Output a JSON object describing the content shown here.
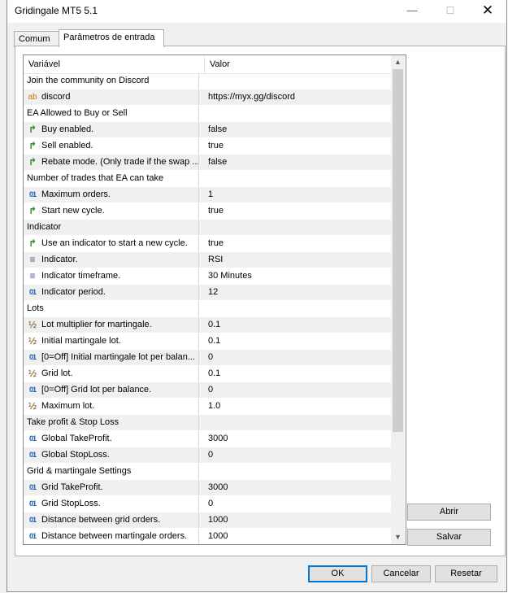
{
  "window": {
    "title": "Gridingale MT5 5.1"
  },
  "tabs": [
    {
      "label": "Comum"
    },
    {
      "label": "Parâmetros de entrada"
    }
  ],
  "grid": {
    "headers": {
      "name": "Variável",
      "value": "Valor"
    },
    "rows": [
      {
        "type": "group",
        "name": "Join the community on Discord",
        "value": ""
      },
      {
        "type": "param",
        "icon": "string-icon",
        "name": "discord",
        "value": "https://myx.gg/discord"
      },
      {
        "type": "group",
        "name": "EA Allowed to Buy or Sell",
        "value": ""
      },
      {
        "type": "param",
        "icon": "bool-icon",
        "name": "Buy enabled.",
        "value": "false"
      },
      {
        "type": "param",
        "icon": "bool-icon",
        "name": "Sell enabled.",
        "value": "true"
      },
      {
        "type": "param",
        "icon": "bool-icon",
        "name": "Rebate mode. (Only trade if the swap ...",
        "value": "false"
      },
      {
        "type": "group",
        "name": "Number of trades that EA can take",
        "value": ""
      },
      {
        "type": "param",
        "icon": "integer-icon",
        "name": "Maximum orders.",
        "value": "1"
      },
      {
        "type": "param",
        "icon": "bool-icon",
        "name": "Start new cycle.",
        "value": "true"
      },
      {
        "type": "group",
        "name": "Indicator",
        "value": ""
      },
      {
        "type": "param",
        "icon": "bool-icon",
        "name": "Use an indicator to start a new cycle.",
        "value": "true"
      },
      {
        "type": "param",
        "icon": "enum-icon",
        "name": "Indicator.",
        "value": "RSI"
      },
      {
        "type": "param",
        "icon": "enum-icon",
        "name": "Indicator timeframe.",
        "value": "30 Minutes"
      },
      {
        "type": "param",
        "icon": "integer-icon",
        "name": "Indicator period.",
        "value": "12"
      },
      {
        "type": "group",
        "name": "Lots",
        "value": ""
      },
      {
        "type": "param",
        "icon": "double-icon",
        "name": "Lot multiplier for martingale.",
        "value": "0.1"
      },
      {
        "type": "param",
        "icon": "double-icon",
        "name": "Initial martingale lot.",
        "value": "0.1"
      },
      {
        "type": "param",
        "icon": "integer-icon",
        "name": "[0=Off] Initial martingale lot per balan...",
        "value": "0"
      },
      {
        "type": "param",
        "icon": "double-icon",
        "name": "Grid lot.",
        "value": "0.1"
      },
      {
        "type": "param",
        "icon": "integer-icon",
        "name": "[0=Off] Grid lot per balance.",
        "value": "0"
      },
      {
        "type": "param",
        "icon": "double-icon",
        "name": "Maximum lot.",
        "value": "1.0"
      },
      {
        "type": "group",
        "name": "Take profit & Stop Loss",
        "value": ""
      },
      {
        "type": "param",
        "icon": "integer-icon",
        "name": "Global TakeProfit.",
        "value": "3000"
      },
      {
        "type": "param",
        "icon": "integer-icon",
        "name": "Global StopLoss.",
        "value": "0"
      },
      {
        "type": "group",
        "name": "Grid & martingale Settings",
        "value": ""
      },
      {
        "type": "param",
        "icon": "integer-icon",
        "name": "Grid TakeProfit.",
        "value": "3000"
      },
      {
        "type": "param",
        "icon": "integer-icon",
        "name": "Grid StopLoss.",
        "value": "0"
      },
      {
        "type": "param",
        "icon": "integer-icon",
        "name": "Distance between grid orders.",
        "value": "1000"
      },
      {
        "type": "param",
        "icon": "integer-icon",
        "name": "Distance between martingale orders.",
        "value": "1000"
      }
    ]
  },
  "icons": {
    "string-icon": "ab",
    "bool-icon": "↱",
    "integer-icon": "01",
    "double-icon": "½",
    "enum-icon": "≡"
  },
  "side_buttons": {
    "load": "Abrir",
    "save": "Salvar"
  },
  "footer_buttons": {
    "ok": "OK",
    "cancel": "Cancelar",
    "reset": "Resetar"
  }
}
